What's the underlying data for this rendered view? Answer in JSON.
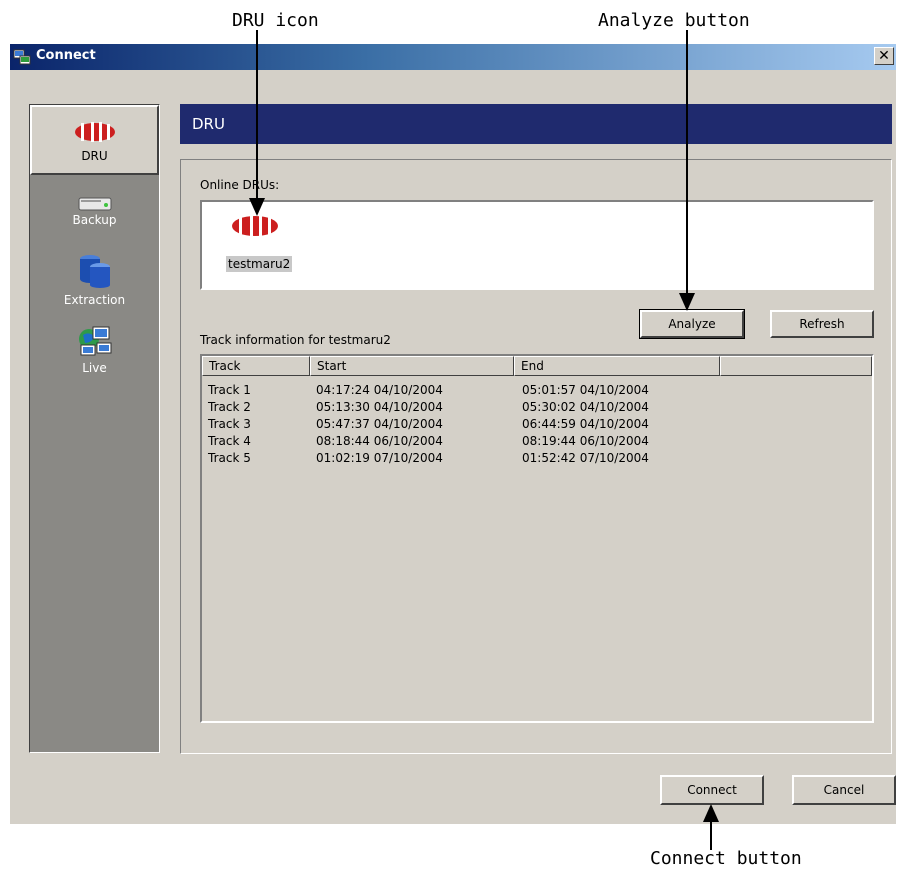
{
  "window": {
    "title": "Connect",
    "close_glyph": "✕"
  },
  "annotations": {
    "dru_icon": "DRU icon",
    "analyze_button": "Analyze button",
    "connect_button": "Connect button"
  },
  "sidebar": {
    "items": [
      {
        "label": "DRU",
        "icon": "dru-icon",
        "selected": true
      },
      {
        "label": "Backup",
        "icon": "backup-drive-icon",
        "selected": false
      },
      {
        "label": "Extraction",
        "icon": "extraction-database-icon",
        "selected": false
      },
      {
        "label": "Live",
        "icon": "live-network-icon",
        "selected": false
      }
    ]
  },
  "panel": {
    "header": "DRU",
    "online_label": "Online DRUs:",
    "dru_name": "testmaru2",
    "analyze_label": "Analyze",
    "refresh_label": "Refresh",
    "track_info_label": "Track information for testmaru2"
  },
  "tracks": {
    "columns": [
      "Track",
      "Start",
      "End",
      ""
    ],
    "rows": [
      {
        "track": "Track 1",
        "start": "04:17:24 04/10/2004",
        "end": "05:01:57 04/10/2004"
      },
      {
        "track": "Track 2",
        "start": "05:13:30 04/10/2004",
        "end": "05:30:02 04/10/2004"
      },
      {
        "track": "Track 3",
        "start": "05:47:37 04/10/2004",
        "end": "06:44:59 04/10/2004"
      },
      {
        "track": "Track 4",
        "start": "08:18:44 06/10/2004",
        "end": "08:19:44 06/10/2004"
      },
      {
        "track": "Track 5",
        "start": "01:02:19 07/10/2004",
        "end": "01:52:42 07/10/2004"
      }
    ]
  },
  "footer": {
    "connect_label": "Connect",
    "cancel_label": "Cancel"
  },
  "colors": {
    "title_gradient_start": "#0a246a",
    "panel_header": "#1f2a6e",
    "sidebar": "#8a8985",
    "dru_red": "#cc1f1f"
  }
}
